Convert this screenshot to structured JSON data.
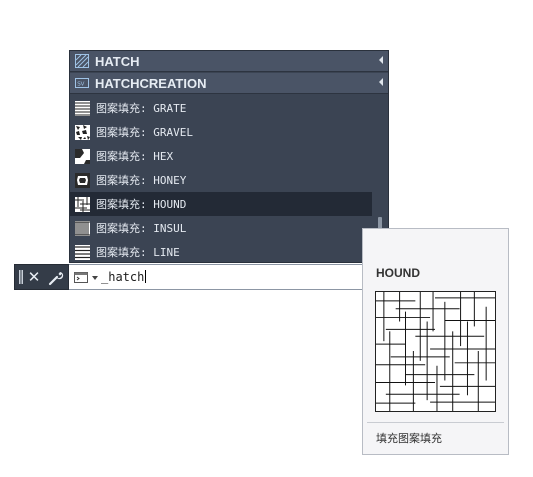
{
  "dropdown": {
    "headers": [
      {
        "icon": "hatch-command-icon",
        "label": "HATCH"
      },
      {
        "icon": "hatch-variable-icon",
        "label": "HATCHCREATION"
      }
    ],
    "items": [
      {
        "icon": "grate-pattern-icon",
        "label": "图案填充: GRATE"
      },
      {
        "icon": "gravel-pattern-icon",
        "label": "图案填充: GRAVEL"
      },
      {
        "icon": "hex-pattern-icon",
        "label": "图案填充: HEX"
      },
      {
        "icon": "honey-pattern-icon",
        "label": "图案填充: HONEY"
      },
      {
        "icon": "hound-pattern-icon",
        "label": "图案填充: HOUND"
      },
      {
        "icon": "insul-pattern-icon",
        "label": "图案填充: INSUL"
      },
      {
        "icon": "line-pattern-icon",
        "label": "图案填充: LINE"
      }
    ],
    "selected_index": 4
  },
  "command_bar": {
    "close_icon": "close-icon",
    "customize_icon": "wrench-icon",
    "prompt_icon": "command-prompt-icon",
    "input_value": "_hatch"
  },
  "tooltip": {
    "title": "HOUND",
    "description": "填充图案填充",
    "preview_icon": "hound-pattern-preview"
  },
  "colors": {
    "dropdown_bg": "#3b4453",
    "header_bg": "#4a5466",
    "selected_bg": "#232a36",
    "text": "#e4e9f0"
  }
}
